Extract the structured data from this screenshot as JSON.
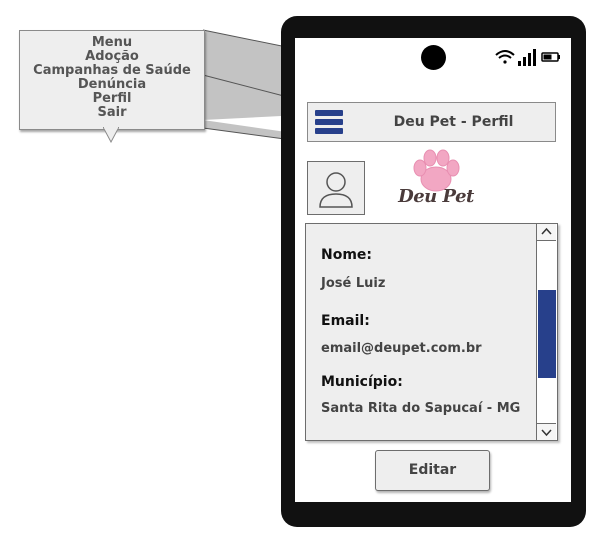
{
  "callout": {
    "title": "Menu",
    "items": [
      "Adoção",
      "Campanhas de Saúde",
      "Denúncia",
      "Perfil",
      "Sair"
    ]
  },
  "header": {
    "title": "Deu Pet - Perfil",
    "menu_icon": "hamburger-menu-icon"
  },
  "status_bar": {
    "icons": [
      "wifi-icon",
      "signal-icon",
      "battery-icon"
    ]
  },
  "logo": {
    "text": "Deu Pet"
  },
  "avatar": {
    "icon": "user-avatar-icon"
  },
  "profile": {
    "fields": [
      {
        "label": "Nome:",
        "value": "José Luiz"
      },
      {
        "label": "Email:",
        "value": "email@deupet.com.br"
      },
      {
        "label": "Município:",
        "value": "Santa Rita do Sapucaí - MG"
      }
    ]
  },
  "actions": {
    "edit_label": "Editar"
  },
  "colors": {
    "accent": "#27408b",
    "panel": "#eeeeee",
    "paw": "#f2a7c3"
  }
}
